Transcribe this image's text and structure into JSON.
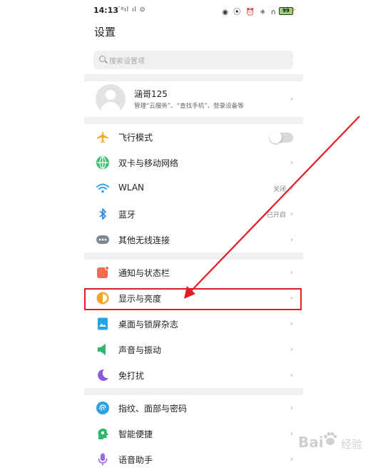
{
  "status_bar": {
    "time": "14:13",
    "left_icons": "´ᵍıl ıl ⊙",
    "right_icons": "◉ ⦿ ⏰ ✳ ∩",
    "battery": "99"
  },
  "header": {
    "title": "设置",
    "search_placeholder": "搜索设置项"
  },
  "account": {
    "name": "涵哥125",
    "subtitle": "管理“云服务”、“查找手机”、登录设备等",
    "chevron": "›"
  },
  "sections": {
    "connectivity": [
      {
        "label": "飞行模式",
        "icon": "airplane-icon",
        "color": "#f5a623",
        "control": "toggle"
      },
      {
        "label": "双卡与移动网络",
        "icon": "globe-icon",
        "color": "#3bbf6b",
        "chevron": "›"
      },
      {
        "label": "WLAN",
        "icon": "wifi-icon",
        "color": "#2aa3e6",
        "value": "关闭",
        "chevron": "›"
      },
      {
        "label": "蓝牙",
        "icon": "bluetooth-icon",
        "color": "#2a8ce6",
        "value": "已开启",
        "chevron": "›"
      },
      {
        "label": "其他无线连接",
        "icon": "more-dots-icon",
        "color": "#7b8896",
        "chevron": "›"
      }
    ],
    "display": [
      {
        "label": "通知与状态栏",
        "icon": "notification-icon",
        "color": "#f26b4d",
        "chevron": "›"
      },
      {
        "label": "显示与亮度",
        "icon": "brightness-icon",
        "color": "#f5a623",
        "chevron": "›"
      },
      {
        "label": "桌面与锁屏杂志",
        "icon": "wallpaper-icon",
        "color": "#2aa3e6",
        "chevron": "›"
      },
      {
        "label": "声音与振动",
        "icon": "speaker-icon",
        "color": "#2fb86a",
        "chevron": "›"
      },
      {
        "label": "免打扰",
        "icon": "moon-icon",
        "color": "#8e5bd8",
        "chevron": "›"
      }
    ],
    "security": [
      {
        "label": "指纹、面部与密码",
        "icon": "fingerprint-icon",
        "color": "#2aa3e6",
        "chevron": "›"
      },
      {
        "label": "智能便捷",
        "icon": "smart-icon",
        "color": "#2fb86a",
        "chevron": "›"
      },
      {
        "label": "语音助手",
        "icon": "mic-icon",
        "color": "#9b6be0",
        "chevron": "›"
      }
    ]
  },
  "annotation": {
    "color": "#e21b24"
  },
  "watermark": {
    "logo": "Bai",
    "brand": "经验"
  }
}
